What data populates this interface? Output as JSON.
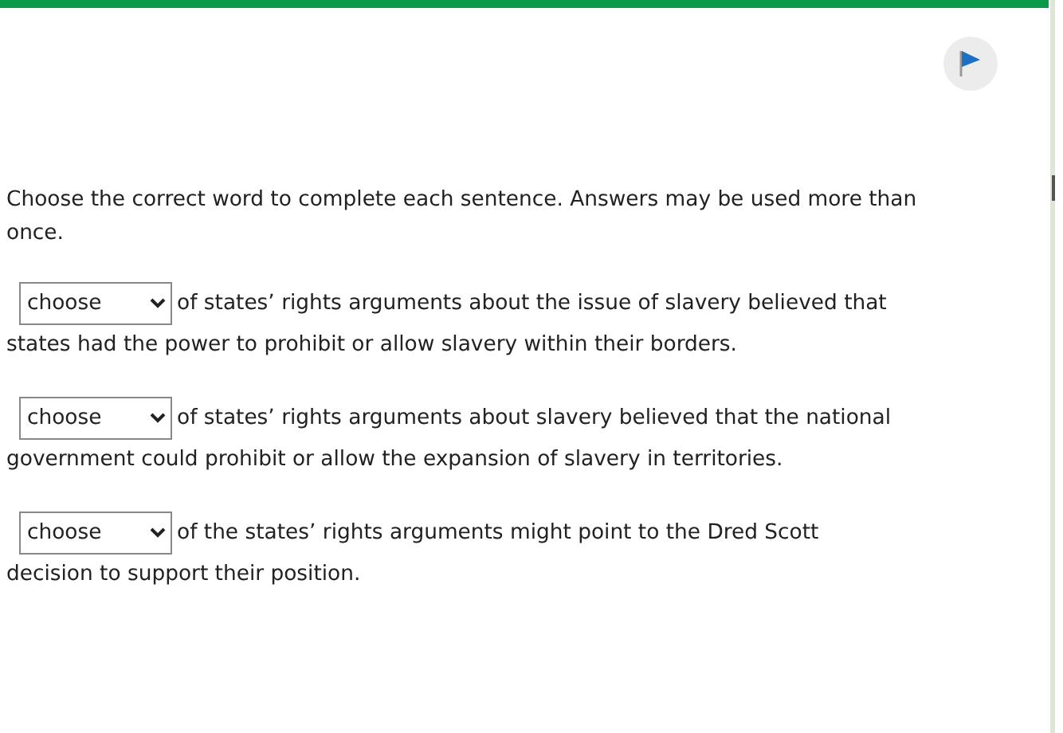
{
  "instructions": "Choose the correct word to complete each sentence.  Answers may be used more than once.",
  "questions": [
    {
      "answer": {
        "value": "choose"
      },
      "text": "of states’ rights arguments about the issue of slavery believed that",
      "continuation": "states had the power to prohibit or allow slavery within their borders."
    },
    {
      "answer": {
        "value": "choose"
      },
      "text": "of states’ rights arguments about slavery believed that the national",
      "continuation": "government could prohibit or allow the expansion of slavery in territories."
    },
    {
      "answer": {
        "value": "choose"
      },
      "text": "of the states’ rights arguments might point to the Dred Scott",
      "continuation": "decision to support their position."
    }
  ]
}
